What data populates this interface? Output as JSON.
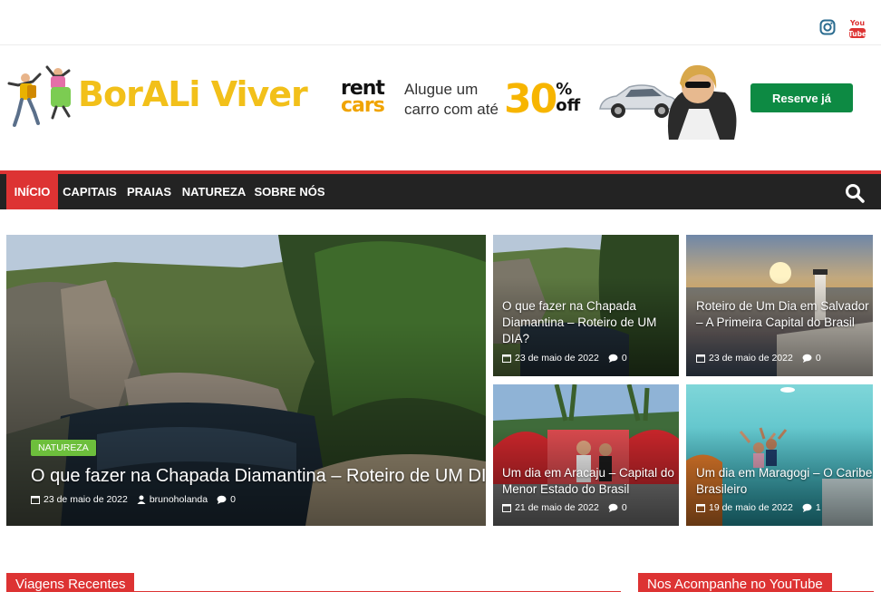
{
  "social": {
    "instagram_icon": "instagram-icon",
    "youtube_label": "You Tube"
  },
  "header": {
    "logo_word1": "BorALi",
    "logo_word2": "Viver",
    "banner": {
      "brand_line1": "rent",
      "brand_line2": "cars",
      "text_line1": "Alugue um",
      "text_line2": "carro com até",
      "discount": "30",
      "discount_suffix_top": "%",
      "discount_suffix_bottom": "off",
      "cta": "Reserve já"
    }
  },
  "nav": {
    "items": [
      {
        "label": "INÍCIO",
        "active": true
      },
      {
        "label": "CAPITAIS",
        "active": false
      },
      {
        "label": "PRAIAS",
        "active": false
      },
      {
        "label": "NATUREZA",
        "active": false
      },
      {
        "label": "SOBRE NÓS",
        "active": false
      }
    ],
    "search_icon": "search-icon"
  },
  "featured": {
    "main": {
      "category": "NATUREZA",
      "title": "O que fazer na Chapada Diamantina – Roteiro de UM DIA?",
      "date": "23 de maio de 2022",
      "author": "brunoholanda",
      "comments": "0"
    },
    "posts": [
      {
        "title": "O que fazer na Chapada Diamantina – Roteiro de UM DIA?",
        "date": "23 de maio de 2022",
        "comments": "0"
      },
      {
        "title": "Roteiro de Um Dia em Salvador – A Primeira Capital do Brasil",
        "date": "23 de maio de 2022",
        "comments": "0"
      },
      {
        "title": "Um dia em Aracaju – Capital do Menor Estado do Brasil",
        "date": "21 de maio de 2022",
        "comments": "0"
      },
      {
        "title": "Um dia em Maragogi – O Caribe Brasileiro",
        "date": "19 de maio de 2022",
        "comments": "1"
      }
    ]
  },
  "sections": {
    "recent_label": "Viagens Recentes",
    "youtube_label": "Nos Acompanhe no YouTube"
  },
  "colors": {
    "accent": "#dd3333",
    "nav_bg": "#232323",
    "badge": "#6dbf3c",
    "cta": "#0d8a43"
  }
}
